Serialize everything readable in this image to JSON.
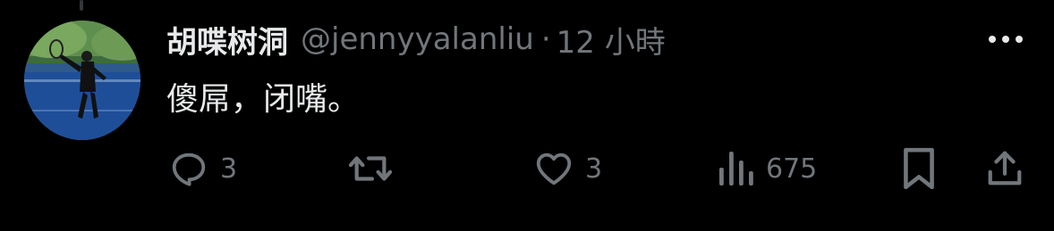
{
  "tweet": {
    "display_name": "胡喋树洞",
    "handle": "@jennyyalanliu",
    "separator": "·",
    "time": "12 小時",
    "text": "傻屌，闭嘴。"
  },
  "actions": {
    "reply_count": "3",
    "repost_count": "",
    "like_count": "3",
    "views_count": "675"
  },
  "icons": {
    "more": "more-horizontal-icon",
    "reply": "reply-icon",
    "repost": "repost-icon",
    "like": "heart-icon",
    "views": "views-chart-icon",
    "bookmark": "bookmark-icon",
    "share": "share-icon"
  },
  "colors": {
    "background": "#000000",
    "primary_text": "#e7e9ea",
    "secondary_text": "#71767b"
  }
}
